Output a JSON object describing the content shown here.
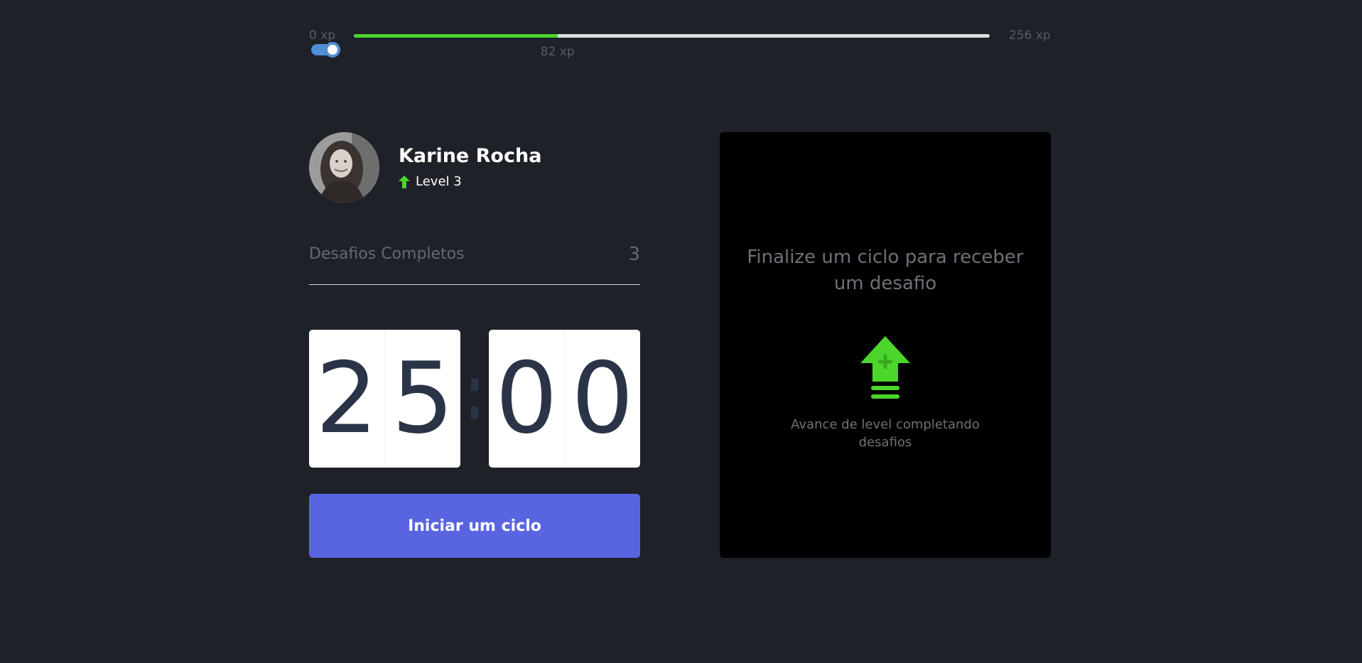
{
  "experience": {
    "min_label": "0 xp",
    "max_label": "256 xp",
    "current_label": "82 xp",
    "current": 82,
    "max": 256
  },
  "colors": {
    "background": "#1f2129",
    "progress_green": "#4cd62b",
    "button_blue": "#5965e0",
    "digit_text": "#2b3447",
    "toggle_blue": "#4f8fd6"
  },
  "profile": {
    "name": "Karine Rocha",
    "level_label": "Level 3",
    "level_icon": "level-up-arrow-icon"
  },
  "challenges": {
    "label": "Desafios Completos",
    "count": "3"
  },
  "countdown": {
    "minutes": [
      "2",
      "5"
    ],
    "seconds": [
      "0",
      "0"
    ]
  },
  "start_button": {
    "label": "Iniciar um ciclo"
  },
  "challenge_box": {
    "title": "Finalize um ciclo para receber um desafio",
    "icon": "level-up-icon",
    "description": "Avance de level completando desafios"
  }
}
